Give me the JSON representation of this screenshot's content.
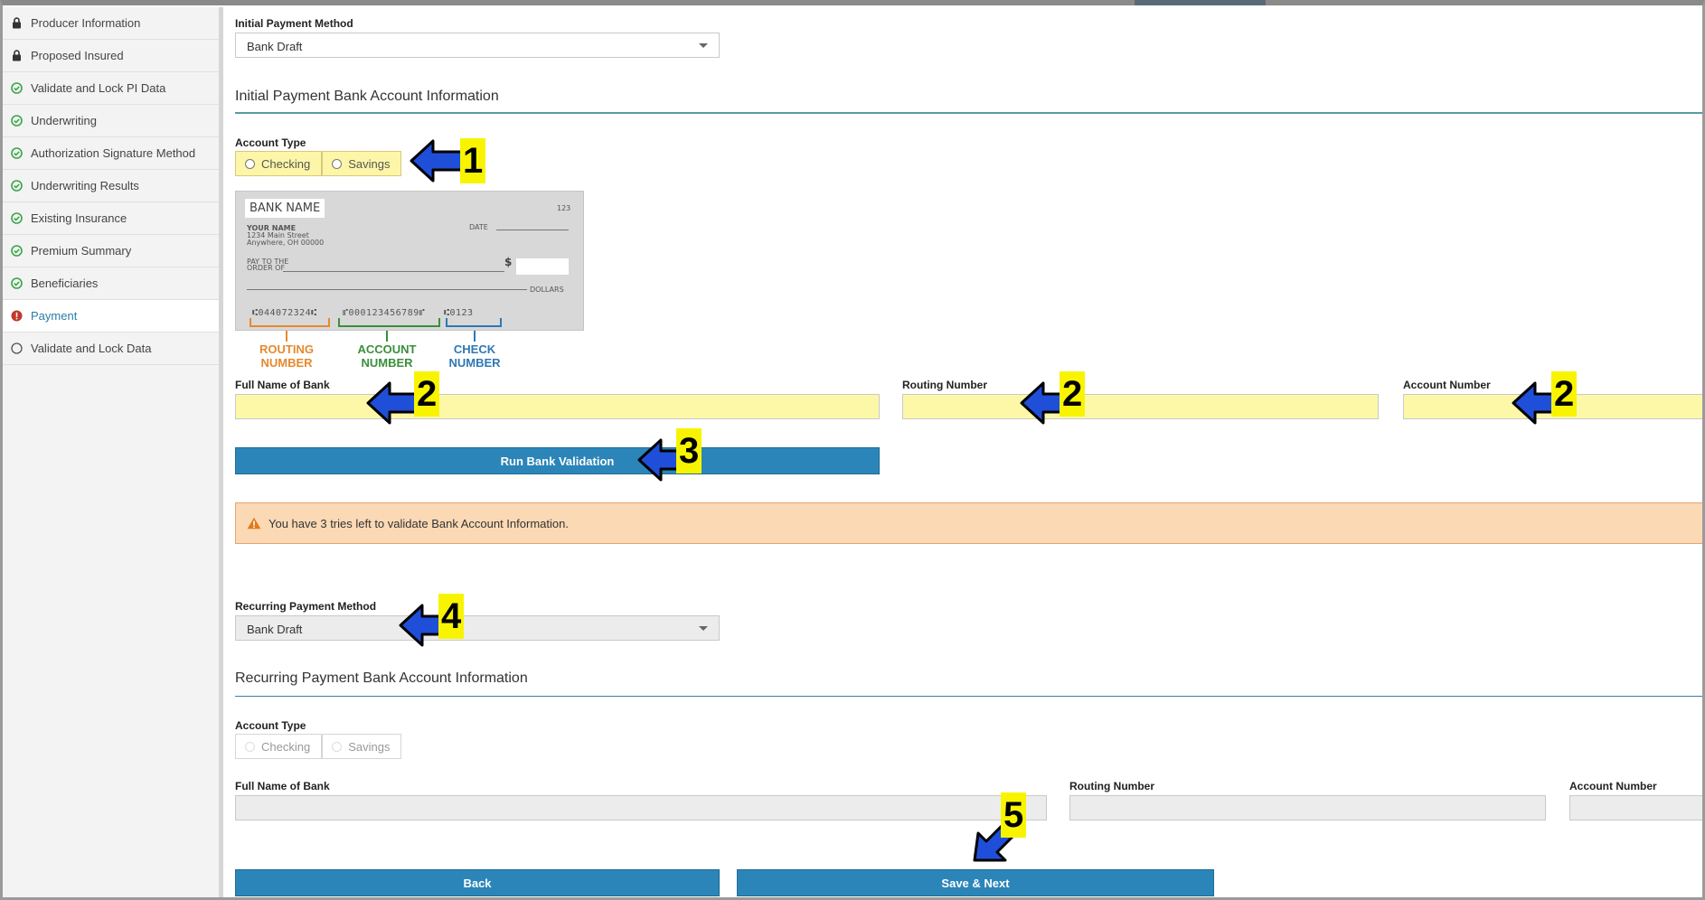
{
  "sidebar": {
    "items": [
      {
        "label": "Producer Information",
        "status": "locked"
      },
      {
        "label": "Proposed Insured",
        "status": "locked"
      },
      {
        "label": "Validate and Lock PI Data",
        "status": "complete"
      },
      {
        "label": "Underwriting",
        "status": "complete"
      },
      {
        "label": "Authorization Signature Method",
        "status": "complete"
      },
      {
        "label": "Underwriting Results",
        "status": "complete"
      },
      {
        "label": "Existing Insurance",
        "status": "complete"
      },
      {
        "label": "Premium Summary",
        "status": "complete"
      },
      {
        "label": "Beneficiaries",
        "status": "complete"
      },
      {
        "label": "Payment",
        "status": "error"
      },
      {
        "label": "Validate and Lock Data",
        "status": "pending"
      }
    ]
  },
  "initial": {
    "method_label": "Initial Payment Method",
    "method_value": "Bank Draft",
    "section_title": "Initial Payment Bank Account Information",
    "account_type_label": "Account Type",
    "checking_label": "Checking",
    "savings_label": "Savings",
    "bank_name_label": "Full Name of Bank",
    "routing_label": "Routing Number",
    "account_label": "Account Number",
    "validate_button": "Run Bank Validation",
    "alert_text": "You have 3 tries left to validate Bank Account Information."
  },
  "check_image": {
    "bank_name": "BANK NAME",
    "number": "123",
    "your_name": "YOUR NAME",
    "street": "1234 Main Street",
    "city": "Anywhere, OH 00000",
    "date": "DATE",
    "pay_to": "PAY TO THE",
    "order_of": "ORDER OF",
    "dollar_sign": "$",
    "dollars": "DOLLARS",
    "micr_routing": "⑆044072324⑆",
    "micr_account": "⑈000123456789⑈",
    "micr_check": "⑆0123",
    "routing_caption_1": "ROUTING",
    "routing_caption_2": "NUMBER",
    "account_caption_1": "ACCOUNT",
    "account_caption_2": "NUMBER",
    "check_caption_1": "CHECK",
    "check_caption_2": "NUMBER"
  },
  "recurring": {
    "method_label": "Recurring Payment Method",
    "method_value": "Bank Draft",
    "section_title": "Recurring Payment Bank Account Information",
    "account_type_label": "Account Type",
    "checking_label": "Checking",
    "savings_label": "Savings",
    "bank_name_label": "Full Name of Bank",
    "routing_label": "Routing Number",
    "account_label": "Account Number"
  },
  "footer": {
    "back_button": "Back",
    "save_button": "Save & Next"
  },
  "annotations": {
    "step1": "1",
    "step2a": "2",
    "step2b": "2",
    "step2c": "2",
    "step3": "3",
    "step4": "4",
    "step5": "5"
  },
  "colors": {
    "accent": "#2b85b8",
    "highlight_field": "#fdf8a8",
    "alert_bg": "#fbd9b5",
    "complete": "#3aa64a",
    "error": "#c0392b",
    "annotation_arrow": "#1f4fd8",
    "annotation_badge": "#f8f400"
  }
}
